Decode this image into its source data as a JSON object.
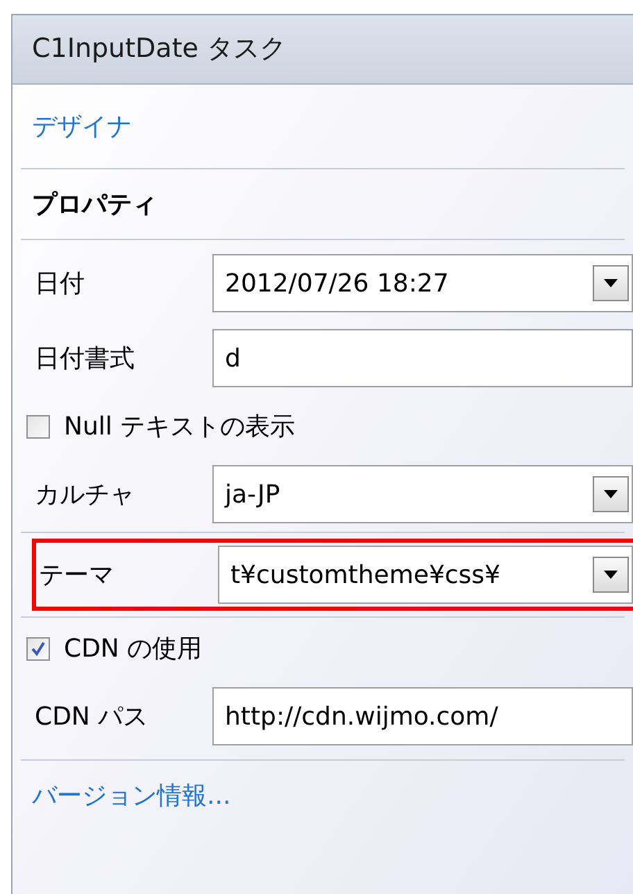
{
  "header": {
    "title": "C1InputDate タスク"
  },
  "designer_link": "デザイナ",
  "section_title": "プロパティ",
  "rows": [
    {
      "kind": "combo",
      "label": "日付",
      "value": "2012/07/26 18:27",
      "highlighted": false
    },
    {
      "kind": "text",
      "label": "日付書式",
      "value": "d",
      "highlighted": false
    },
    {
      "kind": "checkbox",
      "label": "Null テキストの表示",
      "checked": false
    },
    {
      "kind": "combo",
      "label": "カルチャ",
      "value": "ja-JP",
      "highlighted": false
    },
    {
      "kind": "combo",
      "label": "テーマ",
      "value": "t¥customtheme¥css¥",
      "highlighted": true
    },
    {
      "kind": "checkbox",
      "label": "CDN の使用",
      "checked": true
    },
    {
      "kind": "text",
      "label": "CDN パス",
      "value": "http://cdn.wijmo.com/",
      "highlighted": false
    }
  ],
  "version_link": "バージョン情報..."
}
